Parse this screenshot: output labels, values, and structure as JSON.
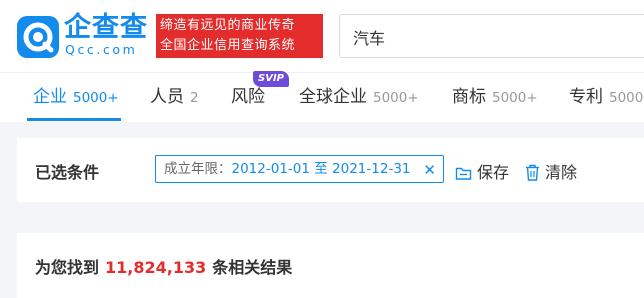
{
  "header": {
    "logo_cn": "企查查",
    "logo_en": "Qcc.com",
    "slogan_line1": "缔造有远见的商业传奇",
    "slogan_line2": "全国企业信用查询系统",
    "search_value": "汽车"
  },
  "tabs": [
    {
      "label": "企业",
      "count": "5000+",
      "active": true
    },
    {
      "label": "人员",
      "count": "2"
    },
    {
      "label": "风险",
      "badge": "SVIP"
    },
    {
      "label": "全球企业",
      "count": "5000+"
    },
    {
      "label": "商标",
      "count": "5000+"
    },
    {
      "label": "专利",
      "count": "5000"
    }
  ],
  "filters": {
    "label": "已选条件",
    "tag_key": "成立年限：",
    "tag_value": "2012-01-01 至 2021-12-31",
    "close_glyph": "✕",
    "save_label": "保存",
    "clear_label": "清除"
  },
  "results": {
    "prefix": "为您找到",
    "count": "11,824,133",
    "suffix": "条相关结果"
  },
  "colors": {
    "brand_blue": "#128bed",
    "slogan_red": "#e32d2d",
    "svip_purple": "#6f4cd8"
  }
}
